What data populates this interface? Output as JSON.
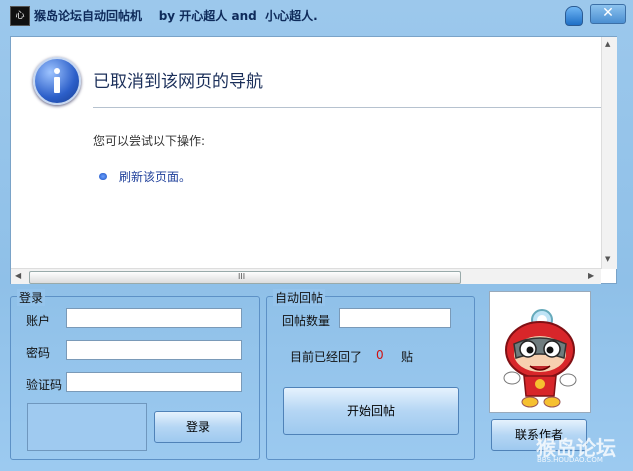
{
  "window": {
    "title": "猴岛论坛自动回帖机    by 开心超人 and  小心超人.",
    "app_icon_text": "心",
    "close_label": "✕"
  },
  "browser": {
    "error_title": "已取消到该网页的导航",
    "try_text": "您可以尝试以下操作:",
    "refresh_link": "刷新该页面。",
    "scroll_grip": "III"
  },
  "login": {
    "group_label": "登录",
    "account_label": "账户",
    "password_label": "密码",
    "captcha_label": "验证码",
    "account_value": "",
    "password_value": "",
    "captcha_value": "",
    "login_button": "登录"
  },
  "autoreply": {
    "group_label": "自动回帖",
    "count_label": "回帖数量",
    "count_value": "",
    "status_prefix": "目前已经回了",
    "status_count": "0",
    "status_suffix": "贴",
    "start_button": "开始回帖"
  },
  "contact": {
    "button": "联系作者"
  },
  "watermark": {
    "main": "猴岛论坛",
    "sub": "BBS.HOUDAO.COM"
  }
}
